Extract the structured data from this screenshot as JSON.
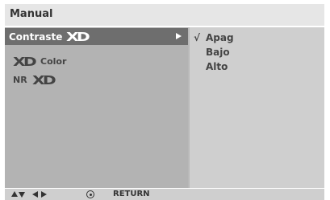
{
  "header": {
    "title": "Manual"
  },
  "menu": {
    "items": [
      {
        "text": "Contraste",
        "logo": "XD",
        "logo_first": false,
        "selected": true
      },
      {
        "text": "Color",
        "logo": "XD",
        "logo_first": true,
        "selected": false
      },
      {
        "text": "NR",
        "logo": "XD",
        "logo_first": false,
        "selected": false
      }
    ]
  },
  "submenu": {
    "options": [
      {
        "label": "Apag",
        "checked": true,
        "check_mark": "√"
      },
      {
        "label": "Bajo",
        "checked": false
      },
      {
        "label": "Alto",
        "checked": false
      }
    ]
  },
  "footer": {
    "return_label": "RETURN"
  },
  "icons": {
    "submenu_arrow": "arrow-right-icon",
    "nav_up": "arrow-up-icon",
    "nav_down": "arrow-down-icon",
    "nav_left": "arrow-left-icon",
    "nav_right": "arrow-right-icon",
    "ok": "ok-button-icon"
  },
  "colors": {
    "selected_bg": "#6e6e6e",
    "left_panel": "#b3b3b3",
    "right_panel": "#cfcfcf",
    "title_bar": "#e6e6e6"
  }
}
